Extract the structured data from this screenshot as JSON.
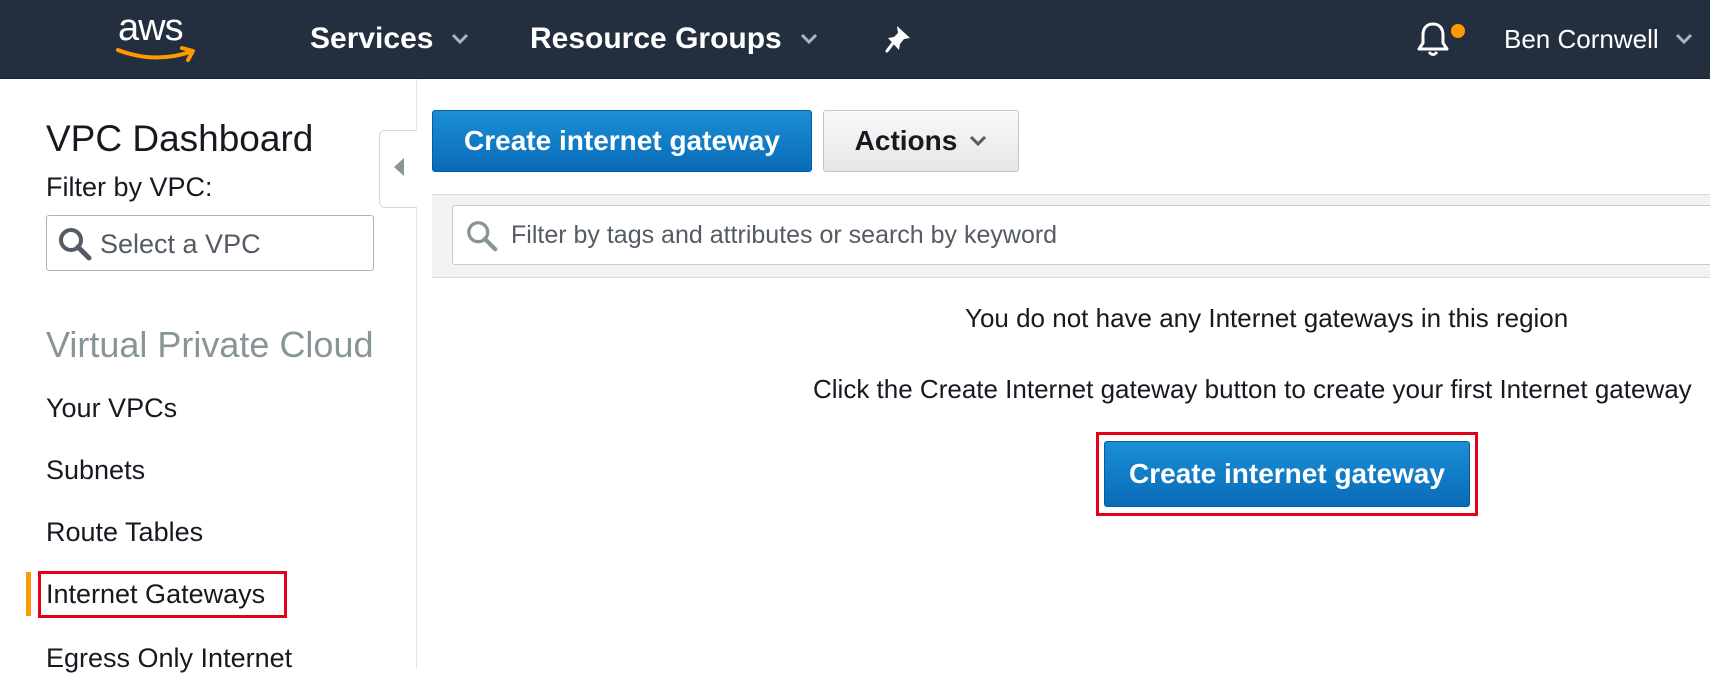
{
  "colors": {
    "nav_bg": "#232f3e",
    "accent": "#ff9900",
    "primary": "#0a6bb8",
    "highlight": "#e2001a"
  },
  "topnav": {
    "logo_text": "aws",
    "services_label": "Services",
    "resource_groups_label": "Resource Groups",
    "pin_icon": "pin-icon",
    "bell_icon": "bell-icon",
    "user_name": "Ben Cornwell"
  },
  "sidebar": {
    "title": "VPC Dashboard",
    "filter_label": "Filter by VPC:",
    "vpc_select_placeholder": "Select a VPC",
    "section_title": "Virtual Private Cloud",
    "items": [
      {
        "label": "Your VPCs"
      },
      {
        "label": "Subnets"
      },
      {
        "label": "Route Tables"
      },
      {
        "label": "Internet Gateways",
        "active": true
      },
      {
        "label": "Egress Only Internet"
      }
    ]
  },
  "toolbar": {
    "create_label": "Create internet gateway",
    "actions_label": "Actions"
  },
  "search": {
    "placeholder": "Filter by tags and attributes or search by keyword"
  },
  "empty_state": {
    "title": "You do not have any Internet gateways in this region",
    "help": "Click the Create Internet gateway button to create your first Internet gateway",
    "button_label": "Create internet gateway"
  }
}
